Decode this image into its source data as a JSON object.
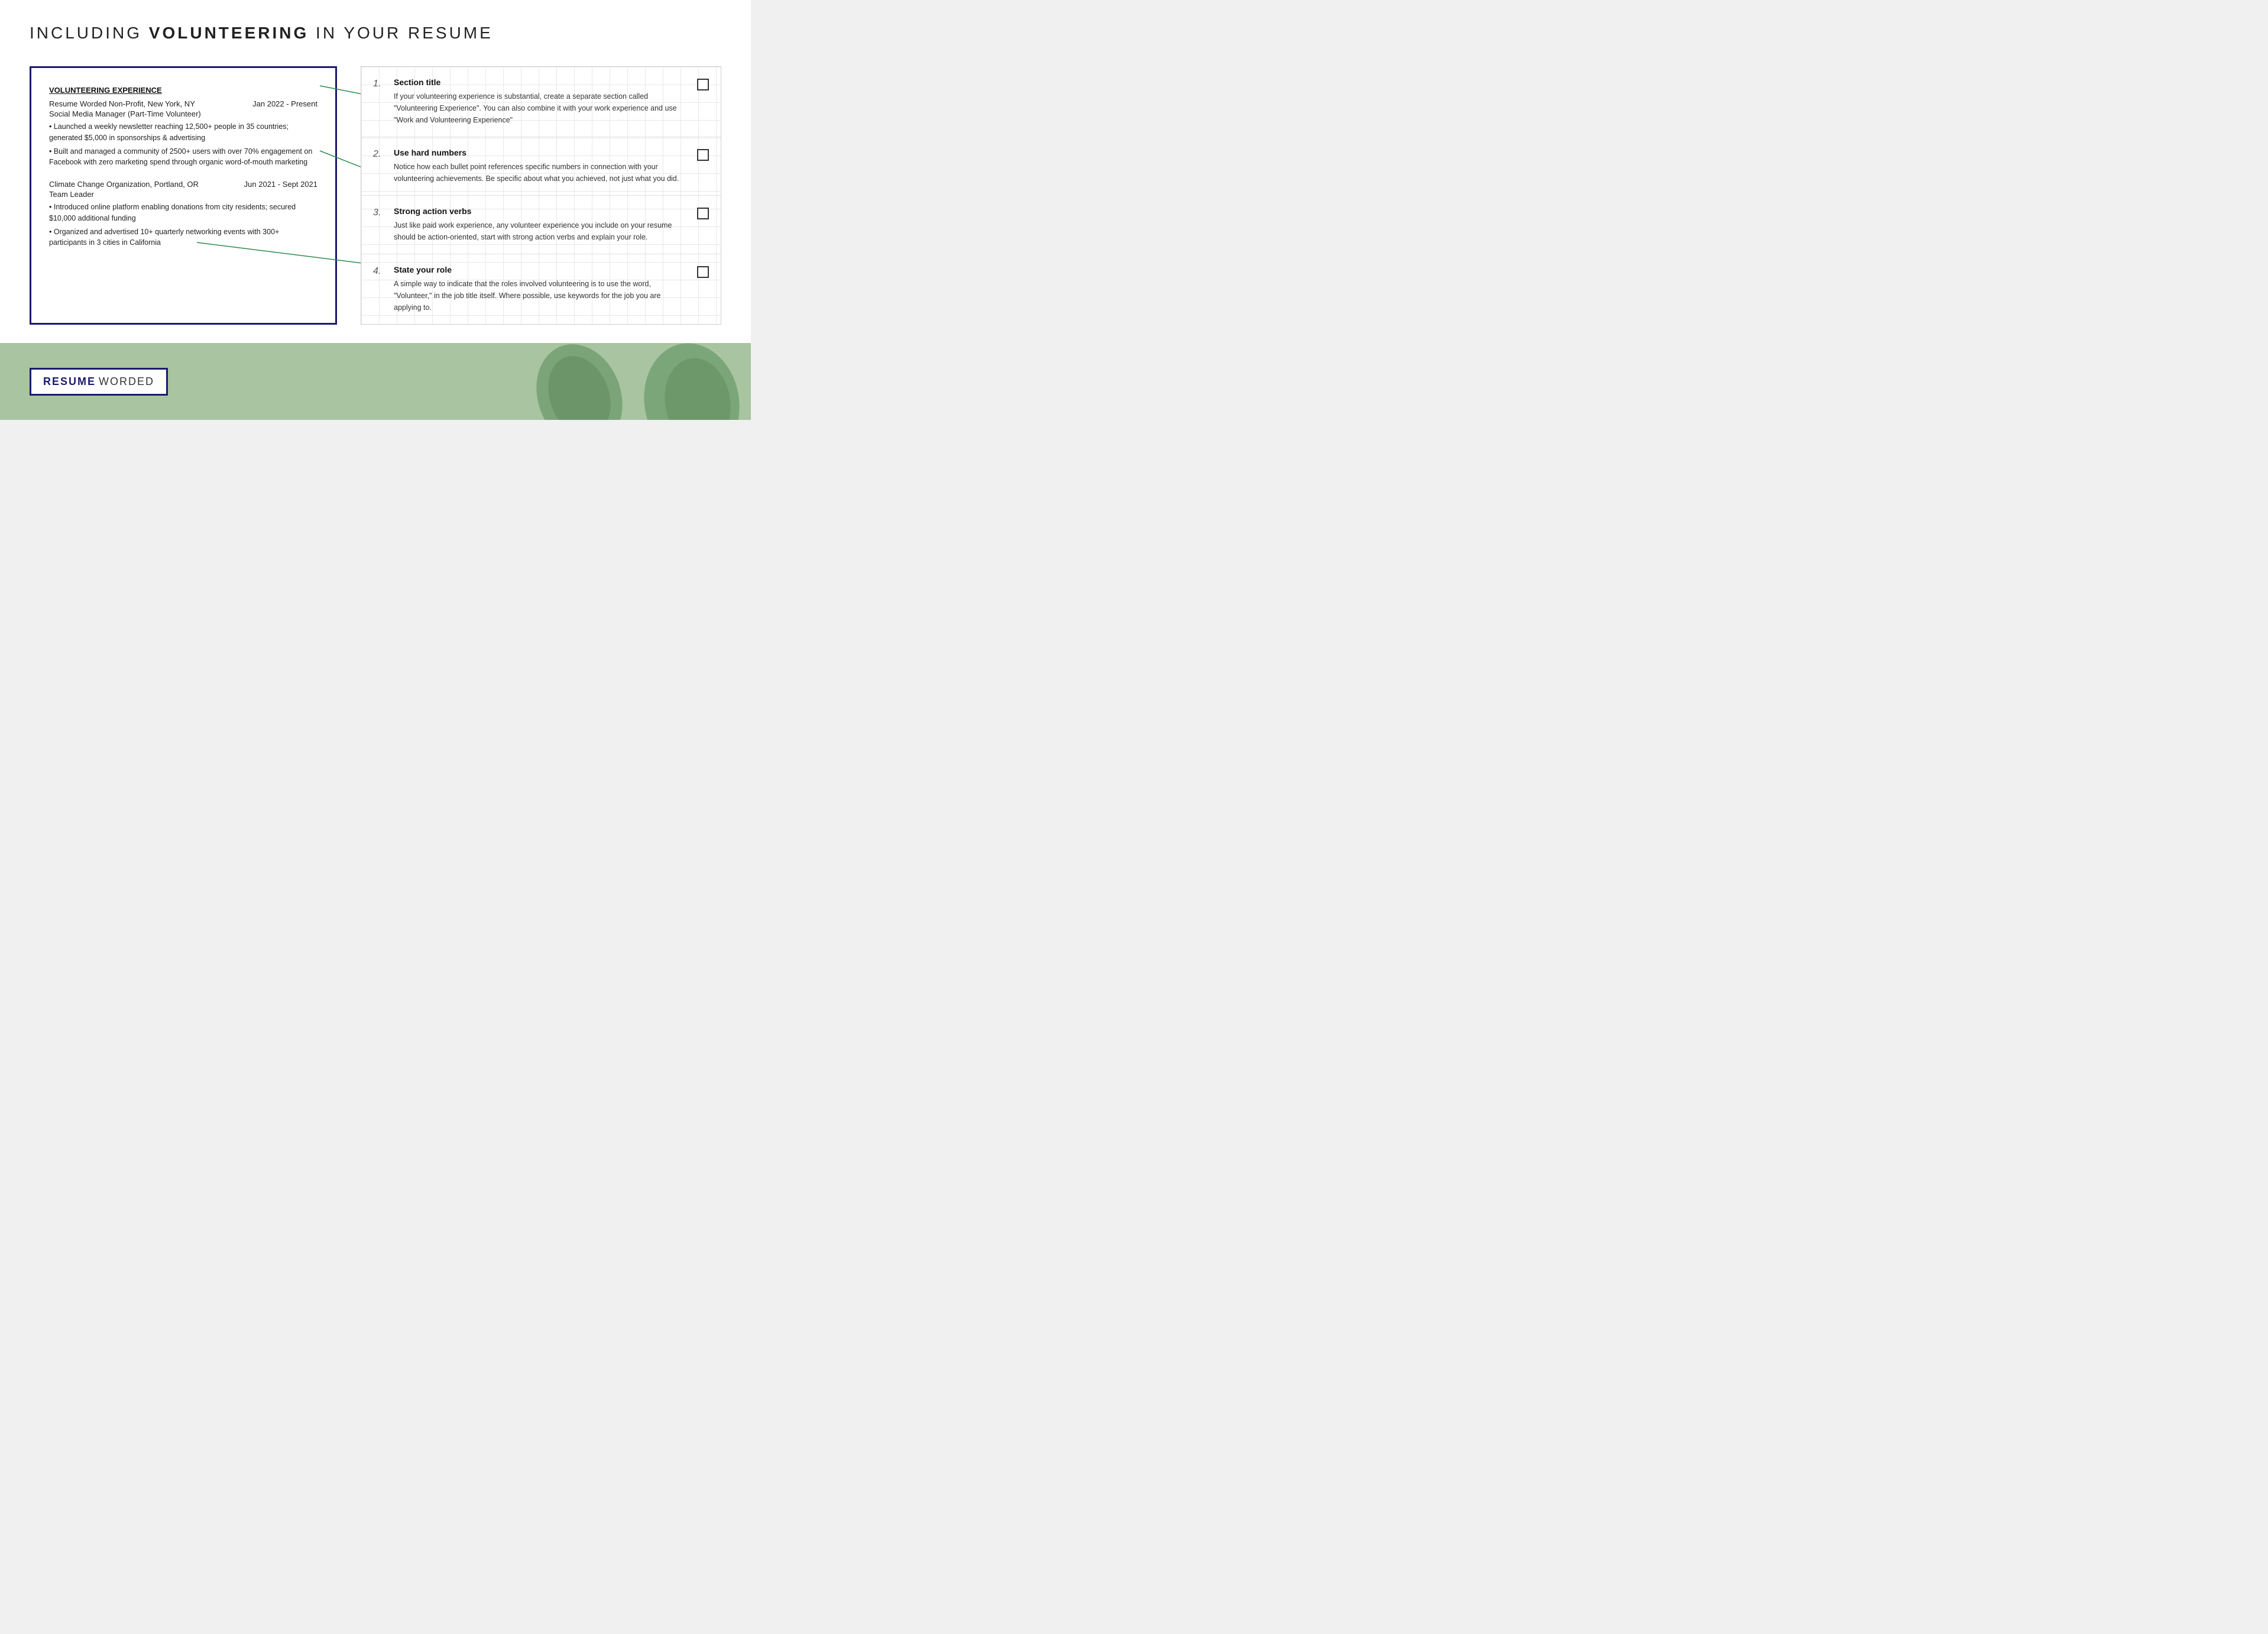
{
  "page": {
    "title_prefix": "INCLUDING ",
    "title_bold": "VOLUNTEERING",
    "title_suffix": " IN YOUR RESUME"
  },
  "resume": {
    "section_title": "VOLUNTEERING EXPERIENCE",
    "entry1": {
      "org": "Resume Worded Non-Profit, New York, NY",
      "date": "Jan 2022 - Present",
      "role": "Social Media Manager (Part-Time Volunteer)",
      "bullet1": "• Launched a weekly newsletter reaching 12,500+ people in 35 countries; generated $5,000 in sponsorships & advertising",
      "bullet2": "• Built and managed a community of 2500+ users with over 70% engagement on Facebook with zero marketing spend through organic word-of-mouth marketing"
    },
    "entry2": {
      "org": "Climate Change Organization, Portland, OR",
      "date": "Jun 2021 - Sept 2021",
      "role": "Team Leader",
      "bullet1": "• Introduced online platform enabling donations from city residents; secured $10,000 additional funding",
      "bullet2": "• Organized and advertised 10+ quarterly networking events with 300+ participants in 3 cities in California"
    }
  },
  "tips": [
    {
      "number": "1.",
      "title": "Section title",
      "description": "If your volunteering experience is substantial, create a separate section called \"Volunteering Experience\". You can also combine it with your work experience and use \"Work and Volunteering Experience\""
    },
    {
      "number": "2.",
      "title": "Use hard numbers",
      "description": "Notice how each bullet point references specific numbers in connection with your volunteering achievements. Be specific about what you achieved, not just what you did."
    },
    {
      "number": "3.",
      "title": "Strong action verbs",
      "description": "Just like paid work experience, any volunteer experience you include on your resume should be action-oriented, start with strong action verbs and explain your role."
    },
    {
      "number": "4.",
      "title": "State your role",
      "description": "A simple way to indicate that the roles involved volunteering is to use the word, \"Volunteer,\" in the job title itself. Where possible, use keywords for the job you are applying to."
    }
  ],
  "footer": {
    "logo_resume": "RESUME",
    "logo_worded": "WORDED"
  }
}
